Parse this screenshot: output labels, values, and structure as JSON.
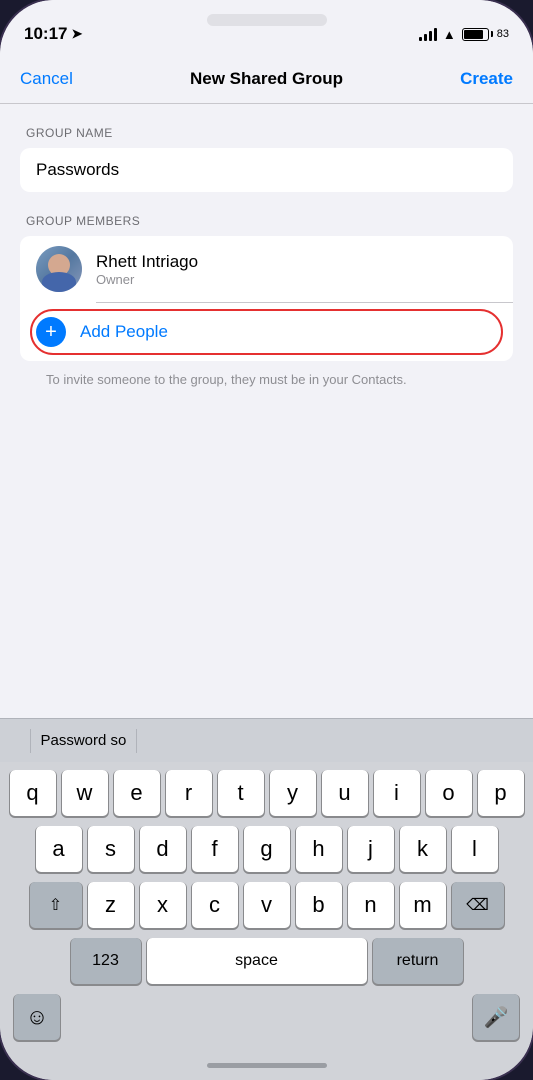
{
  "statusBar": {
    "time": "10:17",
    "battery": "83"
  },
  "navBar": {
    "cancelLabel": "Cancel",
    "title": "New Shared Group",
    "createLabel": "Create"
  },
  "groupNameSection": {
    "label": "GROUP NAME",
    "value": "Passwords"
  },
  "groupMembersSection": {
    "label": "GROUP MEMBERS",
    "members": [
      {
        "name": "Rhett Intriago",
        "role": "Owner"
      }
    ],
    "addPeopleLabel": "Add People"
  },
  "inviteHint": "To invite someone to the group, they must be in your Contacts.",
  "keyboard": {
    "suggestionText": "Password so",
    "rows": [
      [
        "q",
        "w",
        "e",
        "r",
        "t",
        "y",
        "u",
        "i",
        "o",
        "p"
      ],
      [
        "a",
        "s",
        "d",
        "f",
        "g",
        "h",
        "j",
        "k",
        "l"
      ],
      [
        "z",
        "x",
        "c",
        "v",
        "b",
        "n",
        "m"
      ]
    ],
    "bottomLabels": {
      "numbers": "123",
      "space": "space",
      "return": "return"
    }
  },
  "icons": {
    "locationArrow": "➤",
    "plus": "+",
    "emoji": "☺",
    "mic": "🎤",
    "shift": "⇧",
    "backspace": "⌫"
  }
}
